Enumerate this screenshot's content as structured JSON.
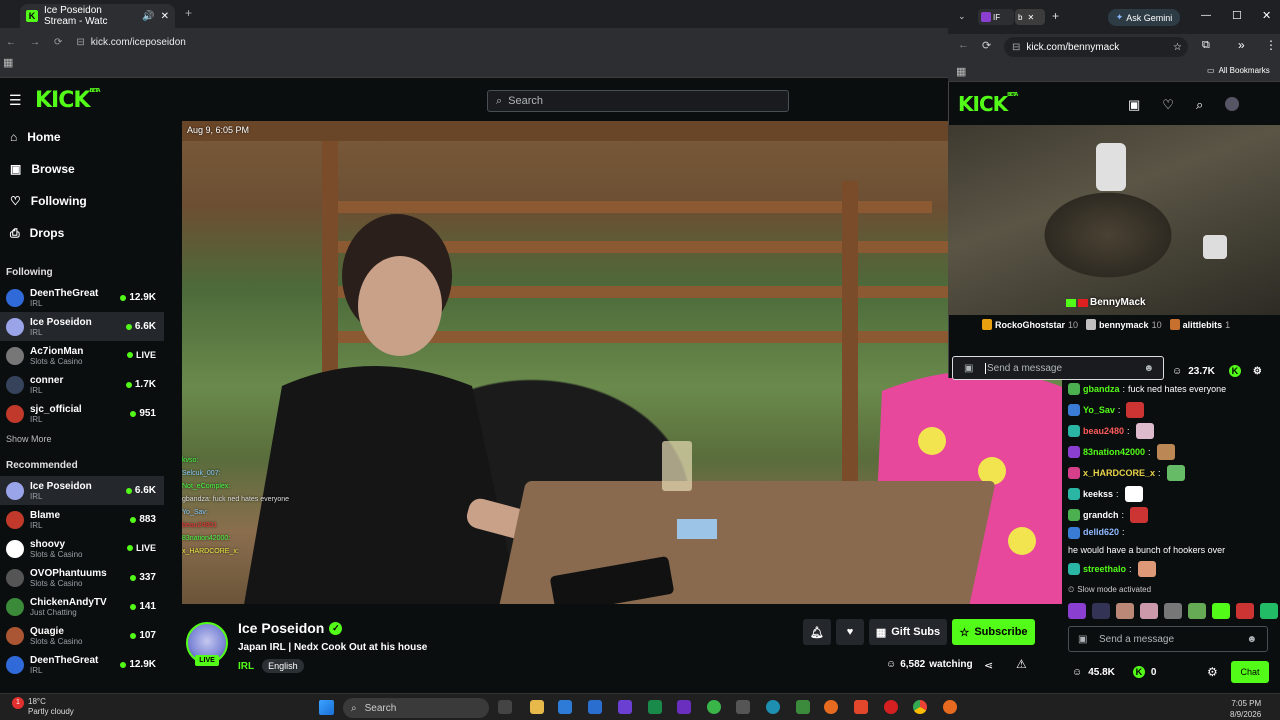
{
  "browser": {
    "tab_title": "Ice Poseidon Stream - Watc",
    "url": "kick.com/iceposeidon"
  },
  "header": {
    "logo": "KICK",
    "beta": "BETA",
    "search_placeholder": "Search"
  },
  "sidebar": {
    "nav": [
      {
        "label": "Home"
      },
      {
        "label": "Browse"
      },
      {
        "label": "Following"
      },
      {
        "label": "Drops"
      }
    ],
    "following_title": "Following",
    "following": [
      {
        "name": "DeenTheGreat",
        "category": "IRL",
        "count": "12.9K",
        "color": "#2f6ad8"
      },
      {
        "name": "Ice Poseidon",
        "category": "IRL",
        "count": "6.6K",
        "color": "#9aa4e8"
      },
      {
        "name": "Ac7ionMan",
        "category": "Slots & Casino",
        "count": "LIVE",
        "color": "#777"
      },
      {
        "name": "conner",
        "category": "IRL",
        "count": "1.7K",
        "color": "#36435a"
      },
      {
        "name": "sjc_official",
        "category": "IRL",
        "count": "951",
        "color": "#c0392b"
      }
    ],
    "show_more": "Show More",
    "recommended_title": "Recommended",
    "recommended": [
      {
        "name": "Ice Poseidon",
        "category": "IRL",
        "count": "6.6K",
        "color": "#9aa4e8"
      },
      {
        "name": "Blame",
        "category": "IRL",
        "count": "883",
        "color": "#c0392b"
      },
      {
        "name": "shoovy",
        "category": "Slots & Casino",
        "count": "LIVE",
        "color": "#ffffff"
      },
      {
        "name": "OVOPhantuums",
        "category": "Slots & Casino",
        "count": "337",
        "color": "#555"
      },
      {
        "name": "ChickenAndyTV",
        "category": "Just Chatting",
        "count": "141",
        "color": "#3a8a3a"
      },
      {
        "name": "Quagie",
        "category": "Slots & Casino",
        "count": "107",
        "color": "#aa5533"
      },
      {
        "name": "DeenTheGreat",
        "category": "IRL",
        "count": "12.9K",
        "color": "#2f6ad8"
      }
    ]
  },
  "video": {
    "timestamp": "Aug 9, 6:05 PM",
    "overlay_chat": [
      "",
      "kvso:",
      "Selcuk_007:",
      "Not_eComplex:",
      "gbandza: fuck ned hates everyone",
      "Yo_Sav:",
      "beau24801",
      "83nation42000:",
      "x_HARDCORE_x:"
    ]
  },
  "stream": {
    "name": "Ice Poseidon",
    "live": "LIVE",
    "title": "Japan IRL | Nedx Cook Out at his house",
    "category": "IRL",
    "tag": "English",
    "gift_label": "Gift Subs",
    "subscribe_label": "Subscribe",
    "viewers": "6,582",
    "watching_label": "watching"
  },
  "popup": {
    "url": "kick.com/bennymack",
    "ask_gemini": "Ask Gemini",
    "all_bookmarks": "All Bookmarks",
    "overlay_name": "BennyMack",
    "leaders": [
      {
        "name": "RockoGhoststar",
        "value": "10"
      },
      {
        "name": "bennymack",
        "value": "10"
      },
      {
        "name": "alittlebits",
        "value": "1"
      }
    ],
    "send_placeholder": "Send a message",
    "viewers": "23.7K"
  },
  "chat": {
    "messages": [
      {
        "user": "gbandza",
        "text": "fuck ned hates everyone",
        "color": "#53fc18"
      },
      {
        "user": "Yo_Sav",
        "text": "",
        "color": "#53fc18"
      },
      {
        "user": "beau2480",
        "text": "",
        "color": "#ff5a5a"
      },
      {
        "user": "83nation42000",
        "text": "",
        "color": "#53fc18"
      },
      {
        "user": "x_HARDCORE_x",
        "text": "",
        "color": "#e8d34a"
      },
      {
        "user": "keekss",
        "text": "",
        "color": "#ffffff"
      },
      {
        "user": "grandch",
        "text": "",
        "color": "#ffffff"
      },
      {
        "user": "delld620",
        "text": "he would have a bunch of hookers over",
        "color": "#8fb8ff"
      },
      {
        "user": "streethalo",
        "text": "",
        "color": "#53fc18"
      }
    ],
    "slow_mode": "Slow mode activated",
    "send_placeholder": "Send a message",
    "viewers": "45.8K",
    "kick_count": "0",
    "chat_button": "Chat"
  },
  "taskbar": {
    "weather_temp": "18°C",
    "weather_desc": "Partly cloudy",
    "search": "Search",
    "time": "7:05 PM",
    "date": "8/9/2026"
  }
}
